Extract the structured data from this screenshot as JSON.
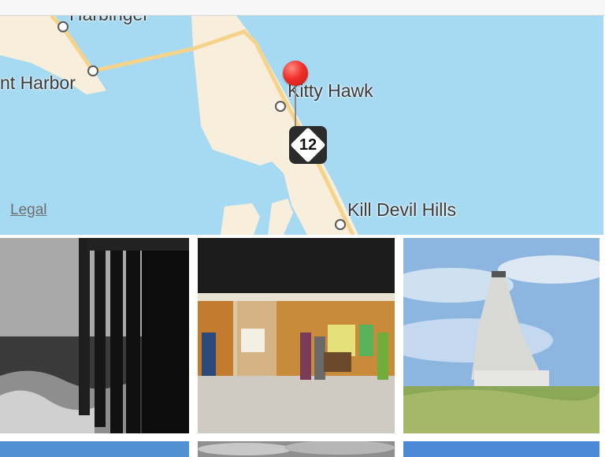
{
  "map": {
    "places": [
      "Harbinger",
      "nt Harbor",
      "Kitty Hawk",
      "Kill Devil Hills"
    ],
    "route_number": "12",
    "legal_label": "Legal",
    "pin_color": "#f0302a",
    "water_color": "#a6d9f2",
    "land_color": "#f8eedc",
    "road_color": "#f6d38a"
  },
  "gallery": {
    "photos": [
      {
        "name": "pier-ocean-photo"
      },
      {
        "name": "museum-interior-photo"
      },
      {
        "name": "monument-photo"
      },
      {
        "name": "sky-photo"
      },
      {
        "name": "cloudy-sky-photo"
      },
      {
        "name": "blue-sky-photo"
      }
    ]
  }
}
